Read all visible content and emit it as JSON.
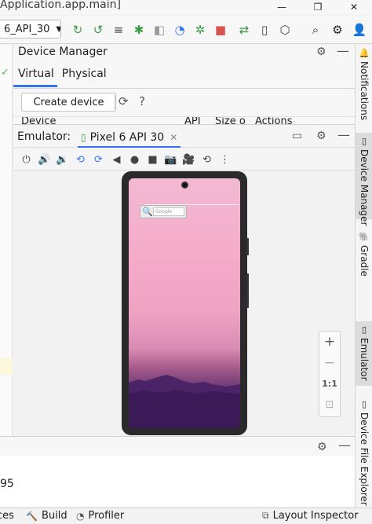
{
  "window": {
    "title": "Application.app.main]",
    "controls": [
      "—",
      "❐",
      "✕"
    ]
  },
  "toolbar": {
    "device_select": "6_API_30",
    "icons": [
      "rerun-icon",
      "apply-changes-icon",
      "run-tests-icon",
      "debug-icon",
      "attach-debugger-icon",
      "profile-icon",
      "debug-apk-icon",
      "stop-icon",
      "sync-icon",
      "device-manager-icon",
      "sdk-manager-icon"
    ],
    "right_icons": [
      "search-icon",
      "settings-icon",
      "user-icon"
    ]
  },
  "device_manager": {
    "title": "Device Manager",
    "tabs": [
      "Virtual",
      "Physical"
    ],
    "active_tab": "Virtual",
    "create_button": "Create device",
    "columns": [
      "Device",
      "API",
      "Size o",
      "Actions"
    ]
  },
  "emulator": {
    "label": "Emulator:",
    "tab_name": "Pixel 6 API 30",
    "search_placeholder": "Google",
    "zoom": {
      "zoom_in": "+",
      "zoom_out": "−",
      "actual_size": "1:1"
    }
  },
  "right_sidebar": {
    "tabs": [
      "Notifications",
      "Device Manager",
      "Gradle",
      "Emulator",
      "Device File Explorer"
    ]
  },
  "bottom_panel": {
    "number": "95"
  },
  "status_bar": {
    "items": [
      "ces",
      "Build",
      "Profiler",
      "Layout Inspector"
    ]
  }
}
